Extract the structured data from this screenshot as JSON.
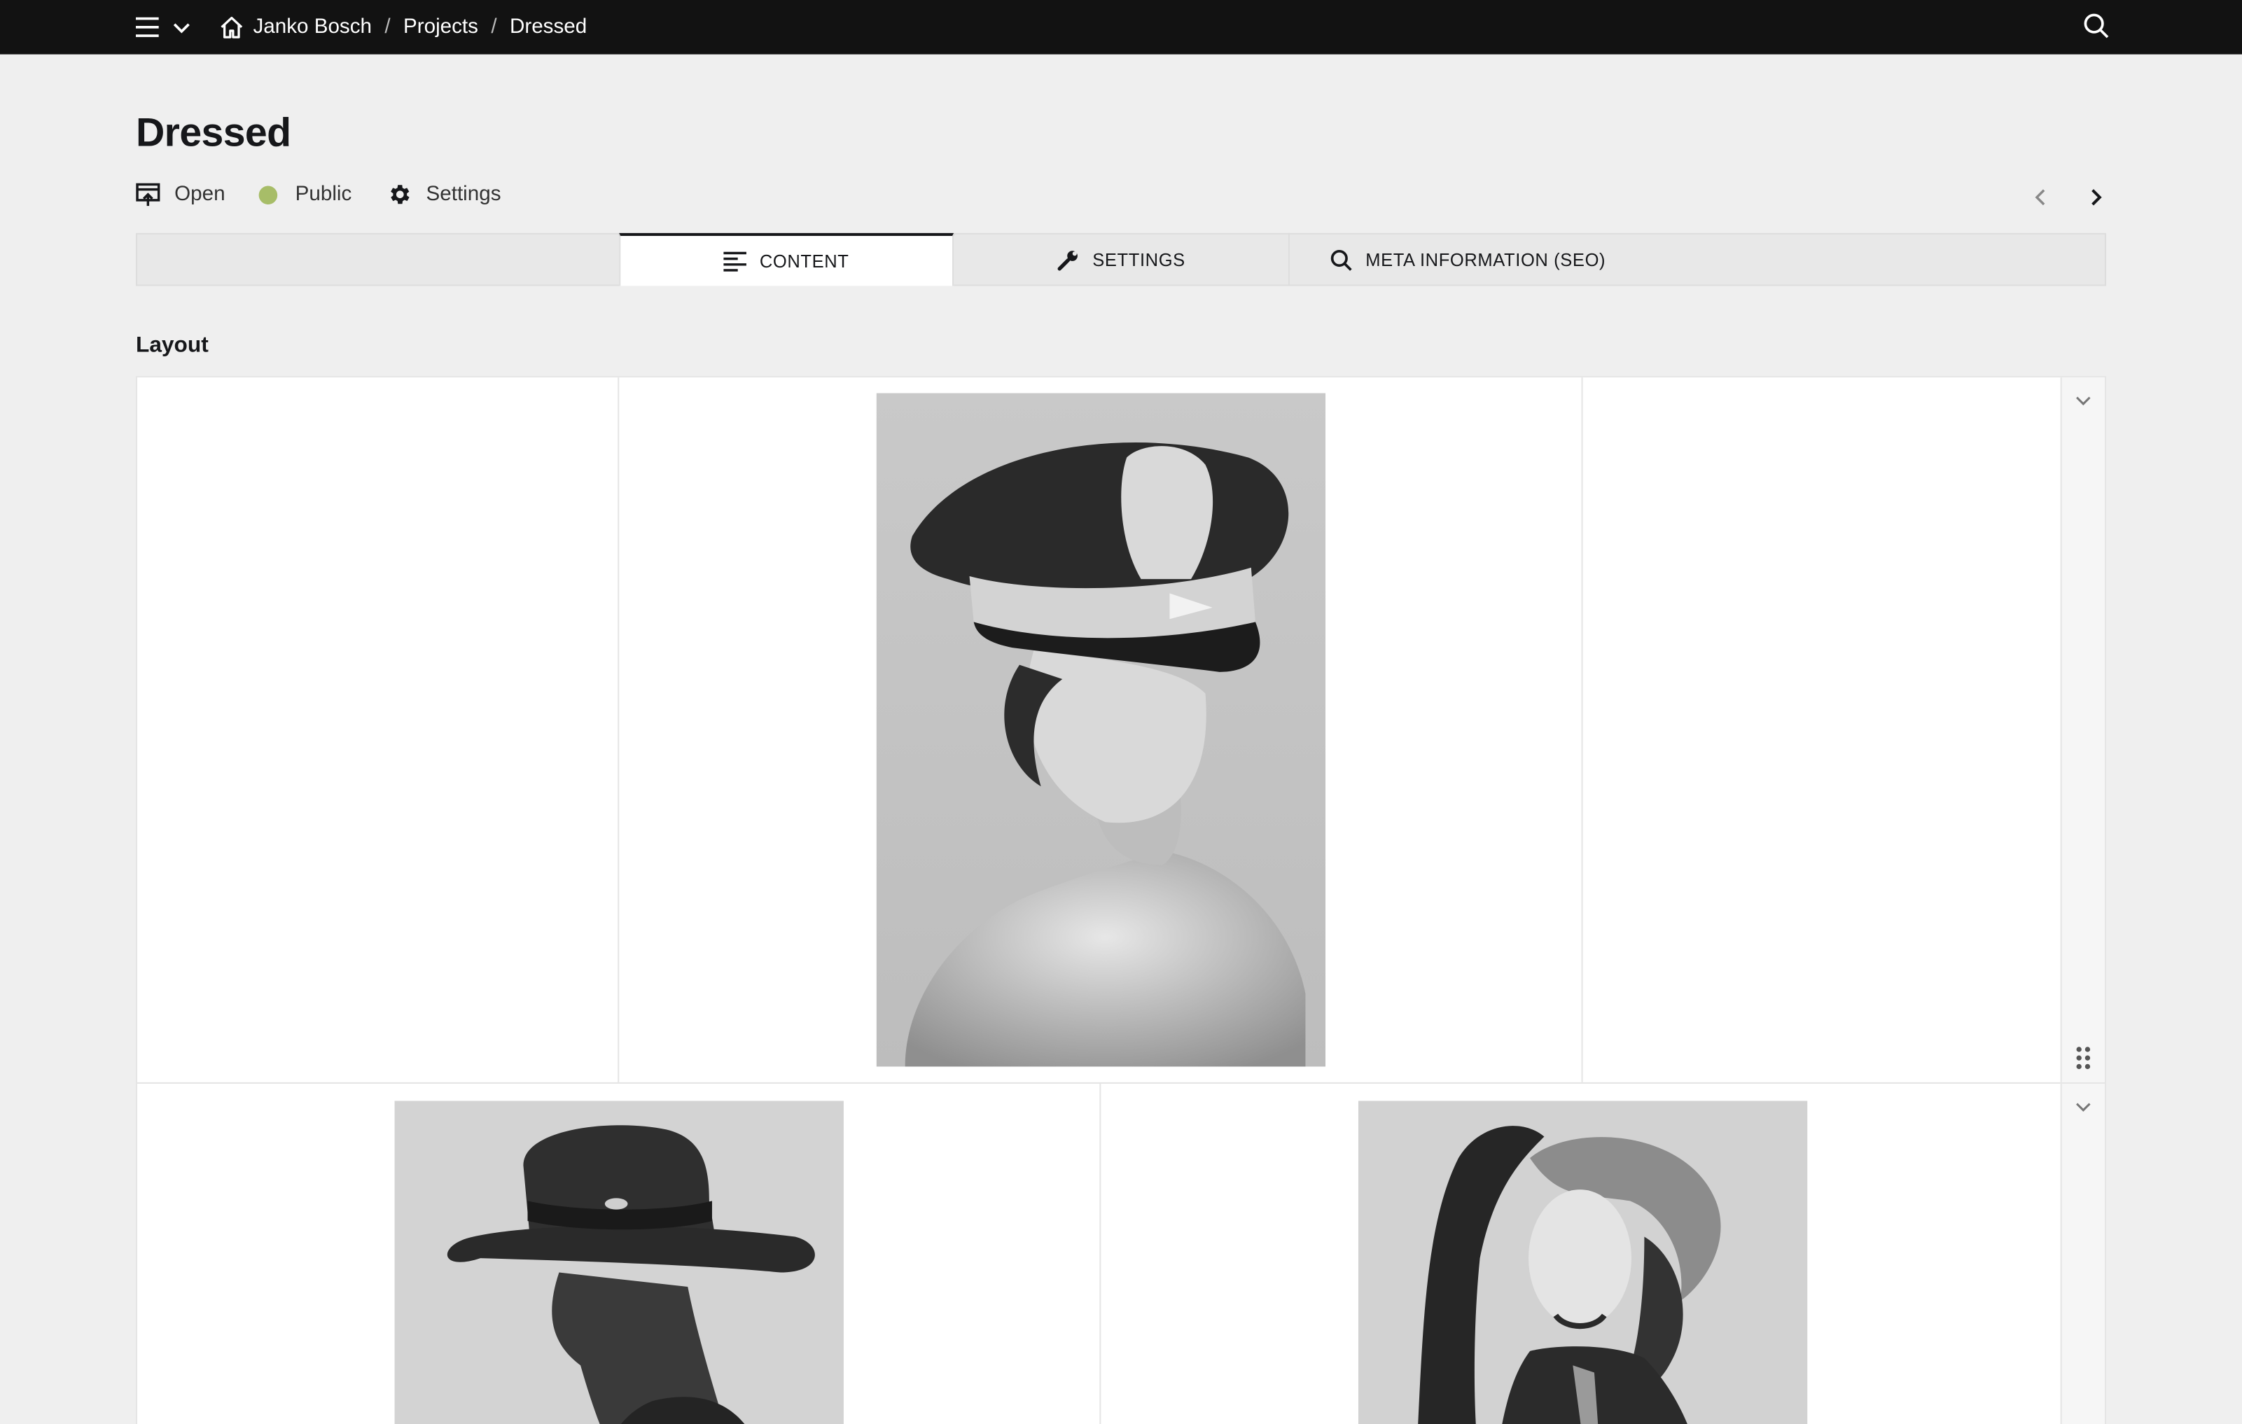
{
  "topbar": {
    "breadcrumb": [
      "Janko Bosch",
      "Projects",
      "Dressed"
    ]
  },
  "page": {
    "title": "Dressed",
    "actions": {
      "open": "Open",
      "status": "Public",
      "status_color": "#a7bd68",
      "settings": "Settings"
    }
  },
  "tabs": {
    "content": "CONTENT",
    "settings": "SETTINGS",
    "seo": "META INFORMATION (SEO)",
    "active": "content"
  },
  "layout": {
    "label": "Layout",
    "rows": [
      {
        "columns": [
          "empty",
          "image",
          "empty"
        ],
        "images": [
          "portrait-officer-cap"
        ]
      },
      {
        "columns": [
          "image",
          "image"
        ],
        "images": [
          "portrait-wide-brim-hat",
          "portrait-woman-hand-on-head"
        ]
      }
    ]
  },
  "icons": {
    "menu": "hamburger-icon",
    "menu_toggle": "chevron-down-icon",
    "home": "home-icon",
    "search": "search-icon",
    "open": "open-preview-icon",
    "settings": "gear-icon",
    "content_tab": "lines-icon",
    "settings_tab": "wrench-icon",
    "seo_tab": "search-icon",
    "prev": "chevron-left-icon",
    "next": "chevron-right-icon",
    "row_toggle": "chevron-down-icon",
    "drag": "drag-handle-icon"
  },
  "colors": {
    "topbar": "#121212",
    "page_background": "#efefef",
    "accent_status": "#a7bd68"
  }
}
